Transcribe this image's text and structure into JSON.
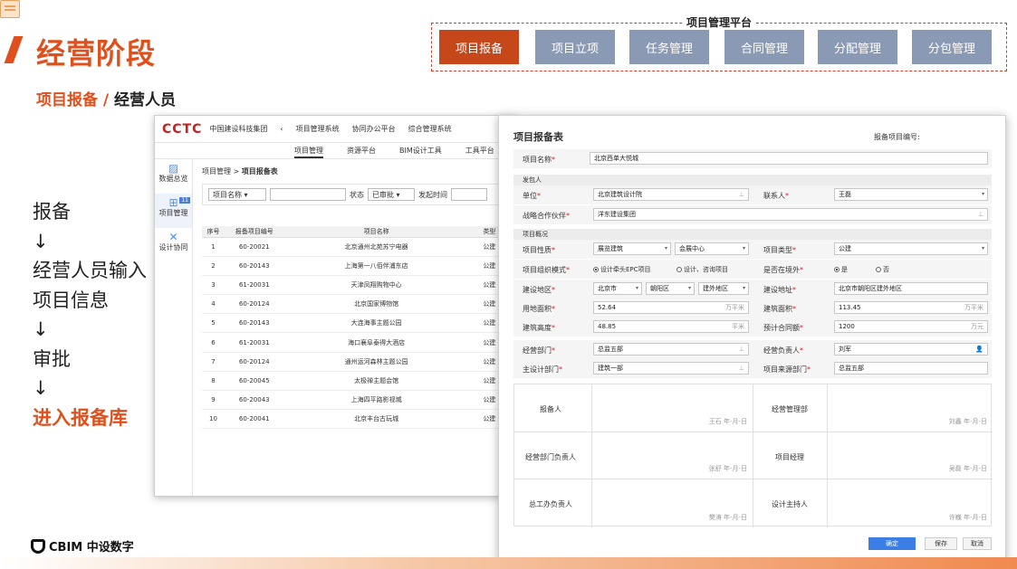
{
  "header": {
    "stage_title": "经营阶段",
    "subtitle_part1": "项目报备 / ",
    "subtitle_part2": "经营人员"
  },
  "platform": {
    "title": "项目管理平台",
    "buttons": [
      "项目报备",
      "项目立项",
      "任务管理",
      "合同管理",
      "分配管理",
      "分包管理"
    ],
    "active": 0
  },
  "flow": {
    "l1": "报备",
    "a1": "↓",
    "l2": "经营人员输入",
    "l3": "项目信息",
    "a2": "↓",
    "l4": "审批",
    "a3": "↓",
    "l5": "进入报备库"
  },
  "footer": {
    "brand": "CBIM 中设数字"
  },
  "colors": {
    "accent": "#e0501c",
    "platform_button": "#8b9ab4",
    "primary": "#3b7ee6"
  },
  "app": {
    "logo": "CCTC",
    "group": "中国建设科技集团",
    "top_nav": [
      "项目管理系统",
      "协同办公平台",
      "综合管理系统"
    ],
    "sub_nav": [
      "项目管理",
      "资源平台",
      "BIM设计工具",
      "工具平台"
    ],
    "side": [
      {
        "icon": "chart-icon",
        "label": "数据总览"
      },
      {
        "icon": "grid-icon",
        "label": "项目管理",
        "badge": "11"
      },
      {
        "icon": "tools-icon",
        "label": "设计协同"
      }
    ],
    "breadcrumb_root": "项目管理 >",
    "breadcrumb_current": "项目报备表",
    "filter": {
      "field": "项目名称",
      "status_label": "状态",
      "status_value": "已审批",
      "time_label": "发起时间"
    },
    "table": {
      "headers": [
        "序号",
        "报备项目编号",
        "项目名称",
        "类型"
      ],
      "rows": [
        [
          "1",
          "60-20021",
          "北京通州北苑苏宁电器",
          "公建"
        ],
        [
          "2",
          "60-20143",
          "上海第一八佰伴浦东店",
          "公建"
        ],
        [
          "3",
          "61-20031",
          "天津凤翔购物中心",
          "公建"
        ],
        [
          "4",
          "60-20124",
          "北京国家博物馆",
          "公建"
        ],
        [
          "5",
          "60-20143",
          "大连海事主题公园",
          "公建"
        ],
        [
          "6",
          "61-20031",
          "海口襄阜泰得大酒店",
          "公建"
        ],
        [
          "7",
          "60-20124",
          "通州运河森林主题公园",
          "公建"
        ],
        [
          "8",
          "60-20045",
          "太极禅主题会馆",
          "公建"
        ],
        [
          "9",
          "60-20043",
          "上海四平路影视城",
          "公建"
        ],
        [
          "10",
          "60-20041",
          "北京丰台古玩城",
          "公建"
        ]
      ]
    }
  },
  "form": {
    "title": "项目报备表",
    "code_label": "报备项目编号:",
    "project_name_label": "项目名称",
    "project_name": "北京西单大悦城",
    "sec_client": "发包人",
    "unit_label": "单位",
    "unit": "北京建筑设计院",
    "contact_label": "联系人",
    "contact": "王磊",
    "partner_label": "战略合作伙伴",
    "partner": "洋东建设集团",
    "sec_overview": "项目概况",
    "nature_label": "项目性质",
    "nature1": "展览建筑",
    "nature2": "会展中心",
    "type_label": "项目类型",
    "type": "公建",
    "org_label": "项目组织模式",
    "org_opt1": "设计牵头EPC项目",
    "org_opt2": "设计、咨询项目",
    "abroad_label": "是否在境外",
    "yes": "是",
    "no": "否",
    "region_label": "建设地区",
    "region1": "北京市",
    "region2": "朝阳区",
    "region3": "建外地区",
    "addr_label": "建设地址",
    "addr": "北京市朝阳区建外地区",
    "land_label": "用地面积",
    "land": "52.64",
    "build_label": "建筑面积",
    "build": "113.45",
    "unit_m2": "万平米",
    "height_label": "建筑高度",
    "height": "48.85",
    "unit_m": "平米",
    "contract_label": "预计合同额",
    "contract": "1200",
    "unit_yuan": "万元",
    "dept_label": "经营部门",
    "dept": "总监五部",
    "mgr_label": "经营负责人",
    "mgr": "刘军",
    "design_label": "主设计部门",
    "design": "建筑一部",
    "source_label": "项目来源部门",
    "source": "总监五部",
    "sig": [
      {
        "label": "报备人",
        "value": "王石  年-月-日"
      },
      {
        "label": "经营管理部",
        "value": "刘鑫  年-月-日"
      },
      {
        "label": "经营部门负责人",
        "value": "张舒  年-月-日"
      },
      {
        "label": "项目经理",
        "value": "吴磊  年-月-日"
      },
      {
        "label": "总工办负责人",
        "value": "樊涛  年-月-日"
      },
      {
        "label": "设计主持人",
        "value": "许巍  年-月-日"
      }
    ],
    "buttons": {
      "ok": "确定",
      "save": "保存",
      "cancel": "取消"
    }
  }
}
